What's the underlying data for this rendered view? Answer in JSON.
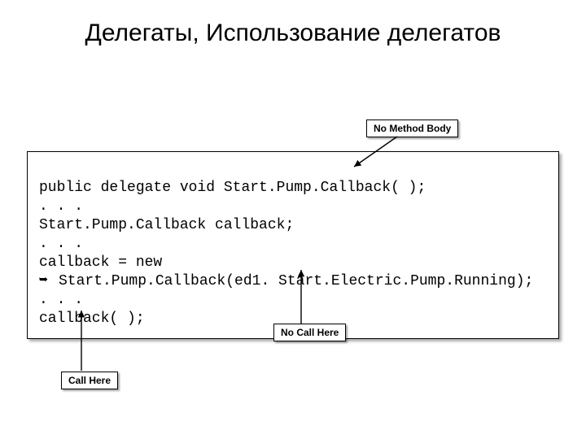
{
  "title": "Делегаты, Использование делегатов",
  "labels": {
    "no_method_body": "No Method Body",
    "no_call_here": "No Call Here",
    "call_here": "Call Here"
  },
  "code": {
    "line1": "public delegate void Start.Pump.Callback( );",
    "line2": ". . .",
    "line3": "Start.Pump.Callback callback;",
    "line4": ". . .",
    "line5": "callback = new",
    "line6_indent_glyph": "➥",
    "line6": "Start.Pump.Callback(ed1. Start.Electric.Pump.Running);",
    "line7": ". . .",
    "line8": "callback( );"
  }
}
